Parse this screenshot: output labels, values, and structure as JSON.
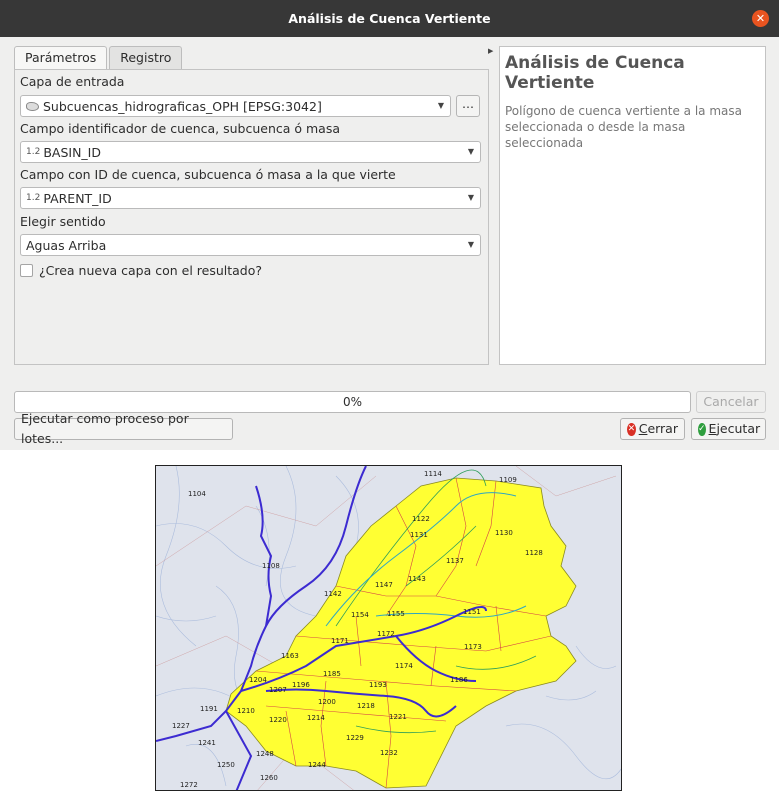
{
  "window": {
    "title": "Análisis de Cuenca Vertiente",
    "close_glyph": "✕"
  },
  "tabs": [
    {
      "label": "Parámetros",
      "active": true
    },
    {
      "label": "Registro",
      "active": false
    }
  ],
  "form": {
    "input_layer_label": "Capa de entrada",
    "input_layer_value": "Subcuencas_hidrograficas_OPH [EPSG:3042]",
    "browse_label": "…",
    "basin_id_label": "Campo identificador de cuenca, subcuenca ó masa",
    "basin_id_type": "1.2",
    "basin_id_value": "BASIN_ID",
    "parent_id_label": "Campo con ID de cuenca, subcuenca ó masa a la que vierte",
    "parent_id_type": "1.2",
    "parent_id_value": "PARENT_ID",
    "direction_label": "Elegir sentido",
    "direction_value": "Aguas Arriba",
    "new_layer_label": "¿Crea nueva capa con el resultado?",
    "new_layer_checked": false
  },
  "help": {
    "title": "Análisis de Cuenca Vertiente",
    "text": "Polígono de cuenca vertiente a la masa seleccionada o desde la masa seleccionada"
  },
  "progress": {
    "text": "0%",
    "value": 0
  },
  "buttons": {
    "cancel": "Cancelar",
    "batch": "Ejecutar como proceso por lotes...",
    "close_prefix": "C",
    "close_rest": "errar",
    "run_prefix": "E",
    "run_rest": "jecutar"
  },
  "colors": {
    "titlebar": "#373737",
    "close_accent": "#e95420",
    "selected_basin": "#ffff33",
    "basin_border": "#d64545",
    "river_main": "#3c2bd1",
    "river_secondary": "#2ea7c2"
  },
  "icons": {
    "layer": "polygon-layer-icon",
    "close_button": "close-icon",
    "run_button": "check-icon",
    "cancel_button": "cross-icon"
  },
  "map": {
    "basin_labels": [
      "1104",
      "1114",
      "1109",
      "1122",
      "1131",
      "1130",
      "1128",
      "1137",
      "1108",
      "1147",
      "1143",
      "1142",
      "1154",
      "1155",
      "1151",
      "1171",
      "1172",
      "1173",
      "1163",
      "1174",
      "1185",
      "1186",
      "1204",
      "1196",
      "1207",
      "1193",
      "1200",
      "1191",
      "1218",
      "1210",
      "1220",
      "1214",
      "1221",
      "1227",
      "1229",
      "1241",
      "1232",
      "1248",
      "1250",
      "1244",
      "1260",
      "1272"
    ]
  }
}
